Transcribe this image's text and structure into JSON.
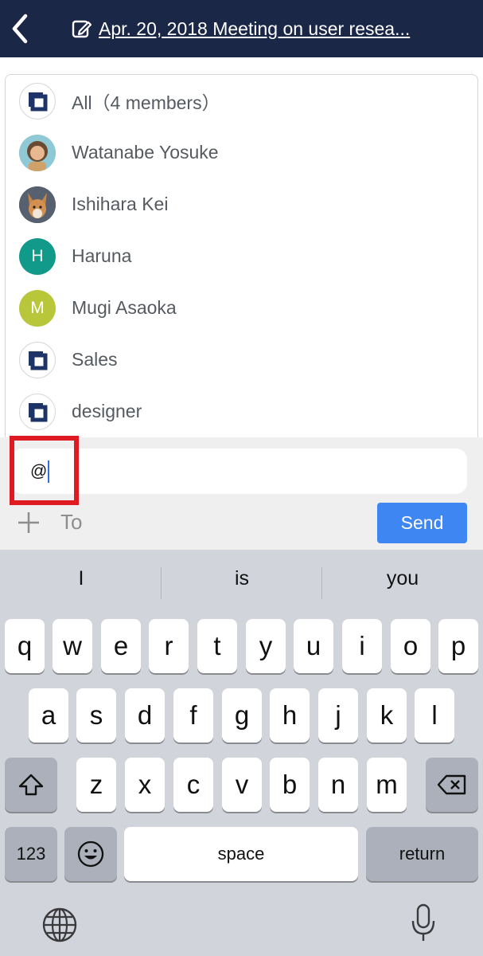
{
  "header": {
    "title": "Apr. 20, 2018 Meeting on user resea...",
    "back_icon": "chevron-left-icon",
    "edit_icon": "edit-note-icon",
    "background": "#1b2747"
  },
  "mentions": [
    {
      "name": "All（4 members）",
      "avatar": "group-logo"
    },
    {
      "name": "Watanabe Yosuke",
      "avatar": "photo-person"
    },
    {
      "name": "Ishihara Kei",
      "avatar": "photo-dog"
    },
    {
      "name": "Haruna",
      "avatar": "letter",
      "letter": "H",
      "color": "#11998a"
    },
    {
      "name": "Mugi Asaoka",
      "avatar": "letter",
      "letter": "M",
      "color": "#b7c739"
    },
    {
      "name": "Sales",
      "avatar": "group-logo"
    },
    {
      "name": "designer",
      "avatar": "group-logo"
    }
  ],
  "composer": {
    "input_value": "@",
    "to_label": "To",
    "send_label": "Send",
    "send_color": "#3e86f2",
    "highlight_color": "#e01a23"
  },
  "keyboard": {
    "suggestions": [
      "I",
      "is",
      "you"
    ],
    "row1": [
      "q",
      "w",
      "e",
      "r",
      "t",
      "y",
      "u",
      "i",
      "o",
      "p"
    ],
    "row2": [
      "a",
      "s",
      "d",
      "f",
      "g",
      "h",
      "j",
      "k",
      "l"
    ],
    "row3": [
      "z",
      "x",
      "c",
      "v",
      "b",
      "n",
      "m"
    ],
    "numbers_label": "123",
    "space_label": "space",
    "return_label": "return"
  }
}
